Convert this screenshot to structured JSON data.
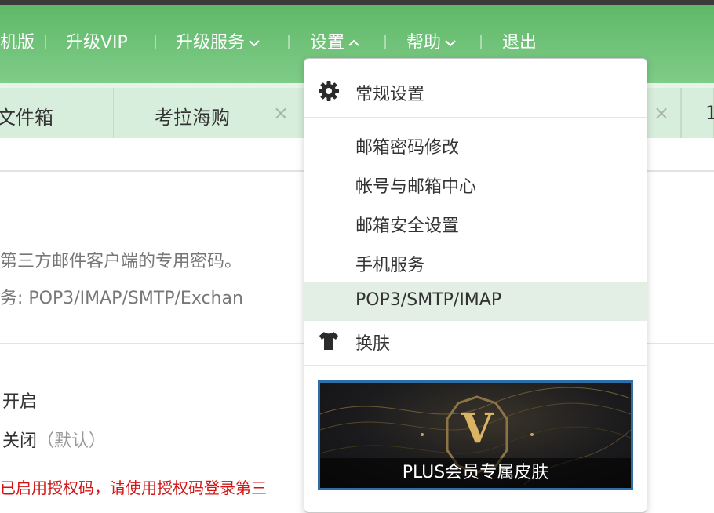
{
  "nav": {
    "items": [
      {
        "label": "机版"
      },
      {
        "label": "升级VIP"
      },
      {
        "label": "升级服务"
      },
      {
        "label": "设置"
      },
      {
        "label": "帮助"
      },
      {
        "label": "退出"
      }
    ],
    "separator": "|"
  },
  "tabs": [
    {
      "label": "文件箱"
    },
    {
      "label": "考拉海购",
      "close": "×"
    },
    {
      "label": "",
      "close": "×"
    },
    {
      "label": "1"
    }
  ],
  "content": {
    "line1": "第三方邮件客户端的专用密码。",
    "line2": "务: POP3/IMAP/SMTP/Exchan",
    "option_on": "开启",
    "option_off": "关闭",
    "option_off_default": "（默认）",
    "warning": "已启用授权码，请使用授权码登录第三"
  },
  "settings_menu": {
    "general": "常规设置",
    "password": "邮箱密码修改",
    "account_center": "帐号与邮箱中心",
    "security": "邮箱安全设置",
    "mobile": "手机服务",
    "pop3": "POP3/SMTP/IMAP",
    "skin": "换肤",
    "banner_caption": "PLUS会员专属皮肤",
    "banner_logo": "V"
  },
  "colors": {
    "nav_green": "#6cc076",
    "tab_accent": "#2e8b3c",
    "warning_red": "#d21414",
    "active_item_bg": "#e3efe4",
    "banner_border": "#2e6fa8",
    "banner_gold": "#c9a55a"
  },
  "icons": {
    "general": "gear-icon",
    "skin": "tshirt-icon",
    "nav_caret_down": "chevron-down-icon",
    "nav_caret_up": "chevron-up-icon",
    "tab_close": "close-icon"
  }
}
